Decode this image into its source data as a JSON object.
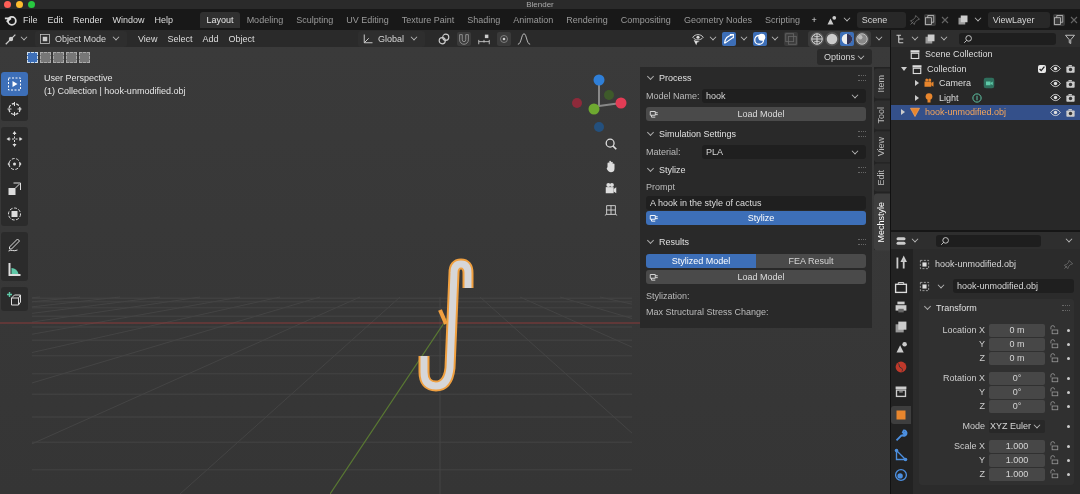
{
  "window": {
    "title": "Blender"
  },
  "menu": [
    "File",
    "Edit",
    "Render",
    "Window",
    "Help"
  ],
  "workspaces": [
    {
      "label": "Layout",
      "selected": true
    },
    {
      "label": "Modeling",
      "selected": false
    },
    {
      "label": "Sculpting",
      "selected": false
    },
    {
      "label": "UV Editing",
      "selected": false
    },
    {
      "label": "Texture Paint",
      "selected": false
    },
    {
      "label": "Shading",
      "selected": false
    },
    {
      "label": "Animation",
      "selected": false
    },
    {
      "label": "Rendering",
      "selected": false
    },
    {
      "label": "Compositing",
      "selected": false
    },
    {
      "label": "Geometry Nodes",
      "selected": false
    },
    {
      "label": "Scripting",
      "selected": false
    }
  ],
  "add_workspace": "+",
  "scene": "Scene",
  "view_layer": "ViewLayer",
  "viewport_header": {
    "mode": "Object Mode",
    "menus": [
      "View",
      "Select",
      "Add",
      "Object"
    ],
    "orientation": "Global",
    "options": "Options"
  },
  "shading_modes": [
    {
      "kind": "wireframe",
      "selected": false
    },
    {
      "kind": "solid",
      "selected": false
    },
    {
      "kind": "material",
      "selected": true
    },
    {
      "kind": "rendered",
      "selected": false
    }
  ],
  "select_modes": [
    {
      "selected": true
    },
    {
      "selected": false
    },
    {
      "selected": false
    },
    {
      "selected": false
    },
    {
      "selected": false
    }
  ],
  "tool_groups": [
    [
      {
        "kind": "select-box",
        "selected": true
      },
      {
        "kind": "cursor",
        "selected": false
      }
    ],
    [
      {
        "kind": "move",
        "selected": false
      },
      {
        "kind": "rotate",
        "selected": false
      },
      {
        "kind": "scale",
        "selected": false
      },
      {
        "kind": "transform",
        "selected": false
      }
    ],
    [
      {
        "kind": "annotate",
        "selected": false
      },
      {
        "kind": "measure",
        "selected": false
      }
    ],
    [
      {
        "kind": "add-cube",
        "selected": false
      }
    ]
  ],
  "overlay": {
    "view_name": "User Perspective",
    "collection_info": "(1) Collection | hook-unmodified.obj"
  },
  "sidebar_tabs": [
    {
      "label": "Item",
      "selected": false
    },
    {
      "label": "Tool",
      "selected": false
    },
    {
      "label": "View",
      "selected": false
    },
    {
      "label": "Edit",
      "selected": false
    },
    {
      "label": "Mechstyle",
      "selected": true
    }
  ],
  "addon": {
    "process": {
      "title": "Process",
      "model_name_label": "Model Name:",
      "model_name": "hook",
      "load_button": "Load Model"
    },
    "simulation": {
      "title": "Simulation Settings",
      "material_label": "Material:",
      "material": "PLA"
    },
    "stylize": {
      "title": "Stylize",
      "prompt_label": "Prompt",
      "prompt": "A hook in the style of cactus",
      "button": "Stylize"
    },
    "results": {
      "title": "Results",
      "tabs": [
        {
          "label": "Stylized Model",
          "selected": true
        },
        {
          "label": "FEA Result",
          "selected": false
        }
      ],
      "load_button": "Load Model",
      "stylization_label": "Stylization:",
      "stress_label": "Max Structural Stress Change:"
    }
  },
  "outliner": {
    "root": "Scene Collection",
    "items": [
      {
        "name": "Collection",
        "kind": "collection",
        "expanded": true,
        "selected": false,
        "checked": true,
        "children": [
          {
            "name": "Camera",
            "kind": "camera",
            "expanded": false,
            "selected": false
          },
          {
            "name": "Light",
            "kind": "light",
            "expanded": false,
            "selected": false
          }
        ]
      },
      {
        "name": "hook-unmodified.obj",
        "kind": "mesh",
        "expanded": false,
        "selected": true
      }
    ]
  },
  "property_tabs": [
    [
      {
        "kind": "tool",
        "selected": false
      }
    ],
    [
      {
        "kind": "render",
        "selected": false
      },
      {
        "kind": "output",
        "selected": false
      },
      {
        "kind": "view_layer",
        "selected": false
      },
      {
        "kind": "scene",
        "selected": false
      },
      {
        "kind": "world",
        "selected": false
      }
    ],
    [
      {
        "kind": "collection",
        "selected": false
      }
    ],
    [
      {
        "kind": "object",
        "selected": true
      },
      {
        "kind": "modifiers",
        "selected": false
      },
      {
        "kind": "particles",
        "selected": false
      },
      {
        "kind": "physics",
        "selected": false
      }
    ]
  ],
  "properties": {
    "object_name": "hook-unmodified.obj",
    "data_name": "hook-unmodified.obj",
    "transform": {
      "title": "Transform",
      "groups": [
        [
          {
            "label": "Location X",
            "value": "0 m",
            "kind": "field"
          },
          {
            "label": "Y",
            "value": "0 m",
            "kind": "field"
          },
          {
            "label": "Z",
            "value": "0 m",
            "kind": "field"
          }
        ],
        [
          {
            "label": "Rotation X",
            "value": "0°",
            "kind": "field"
          },
          {
            "label": "Y",
            "value": "0°",
            "kind": "field"
          },
          {
            "label": "Z",
            "value": "0°",
            "kind": "field"
          }
        ],
        [
          {
            "label": "Mode",
            "value": "XYZ Euler",
            "kind": "dropdown"
          }
        ],
        [
          {
            "label": "Scale X",
            "value": "1.000",
            "kind": "field"
          },
          {
            "label": "Y",
            "value": "1.000",
            "kind": "field"
          },
          {
            "label": "Z",
            "value": "1.000",
            "kind": "field"
          }
        ]
      ]
    }
  }
}
